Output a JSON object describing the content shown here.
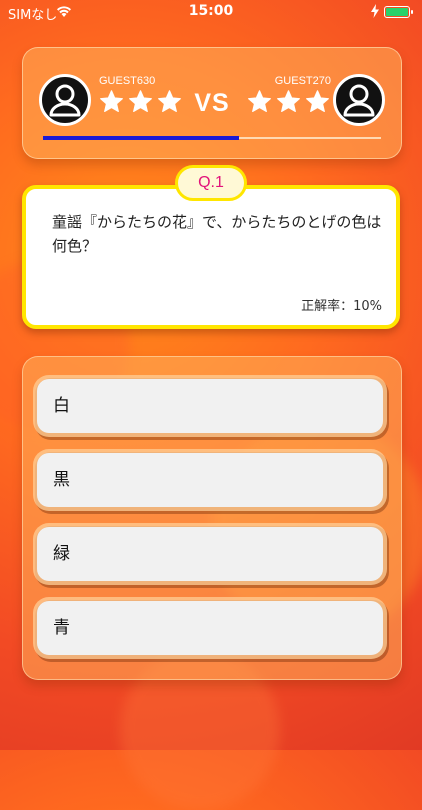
{
  "status_bar": {
    "carrier": "SIMなし",
    "time": "15:00",
    "battery_color": "#29d16a"
  },
  "match": {
    "player_left": {
      "name": "GUEST630",
      "stars": 3,
      "avatar_icon": "user-avatar-icon"
    },
    "player_right": {
      "name": "GUEST270",
      "stars": 3,
      "avatar_icon": "user-avatar-icon"
    },
    "vs_label": "VS",
    "progress": 0.58
  },
  "question": {
    "number_label": "Q.1",
    "text": "童謡『からたちの花』で、からたちのとげの色は何色？",
    "correct_rate": "正解率：10%"
  },
  "answers": [
    {
      "label": "白"
    },
    {
      "label": "黒"
    },
    {
      "label": "緑"
    },
    {
      "label": "青"
    }
  ],
  "colors": {
    "badge_text": "#e2137a",
    "card_border": "#ffe600",
    "progress_fill": "#1a1ad6"
  }
}
